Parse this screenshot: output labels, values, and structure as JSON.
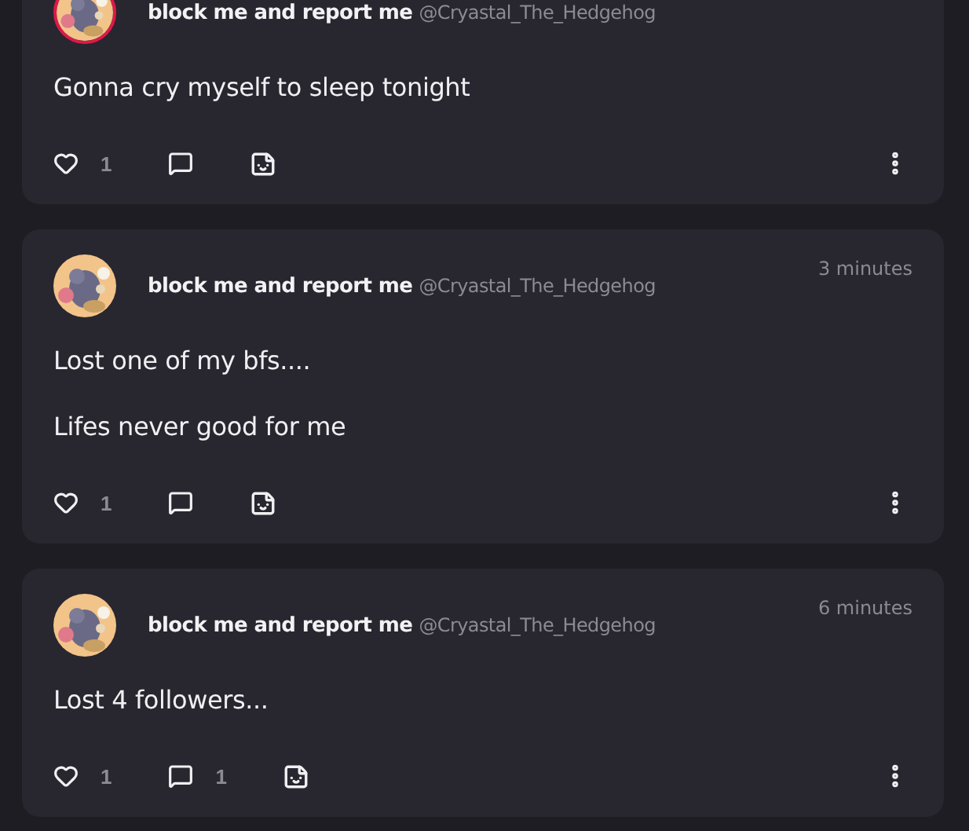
{
  "posts": [
    {
      "ring": true,
      "name": "block me and report me",
      "handle": "@Cryastal_The_Hedgehog",
      "body": [
        "Gonna cry myself to sleep tonight"
      ],
      "likes": "1"
    },
    {
      "ring": false,
      "name": "block me and report me",
      "handle": "@Cryastal_The_Hedgehog",
      "time": "3 minutes",
      "body": [
        "Lost one of my bfs....",
        "Lifes never good for me"
      ],
      "likes": "1"
    },
    {
      "ring": false,
      "name": "block me and report me",
      "handle": "@Cryastal_The_Hedgehog",
      "time": "6 minutes",
      "body": [
        "Lost 4 followers..."
      ],
      "likes": "1",
      "comments": "1"
    }
  ]
}
